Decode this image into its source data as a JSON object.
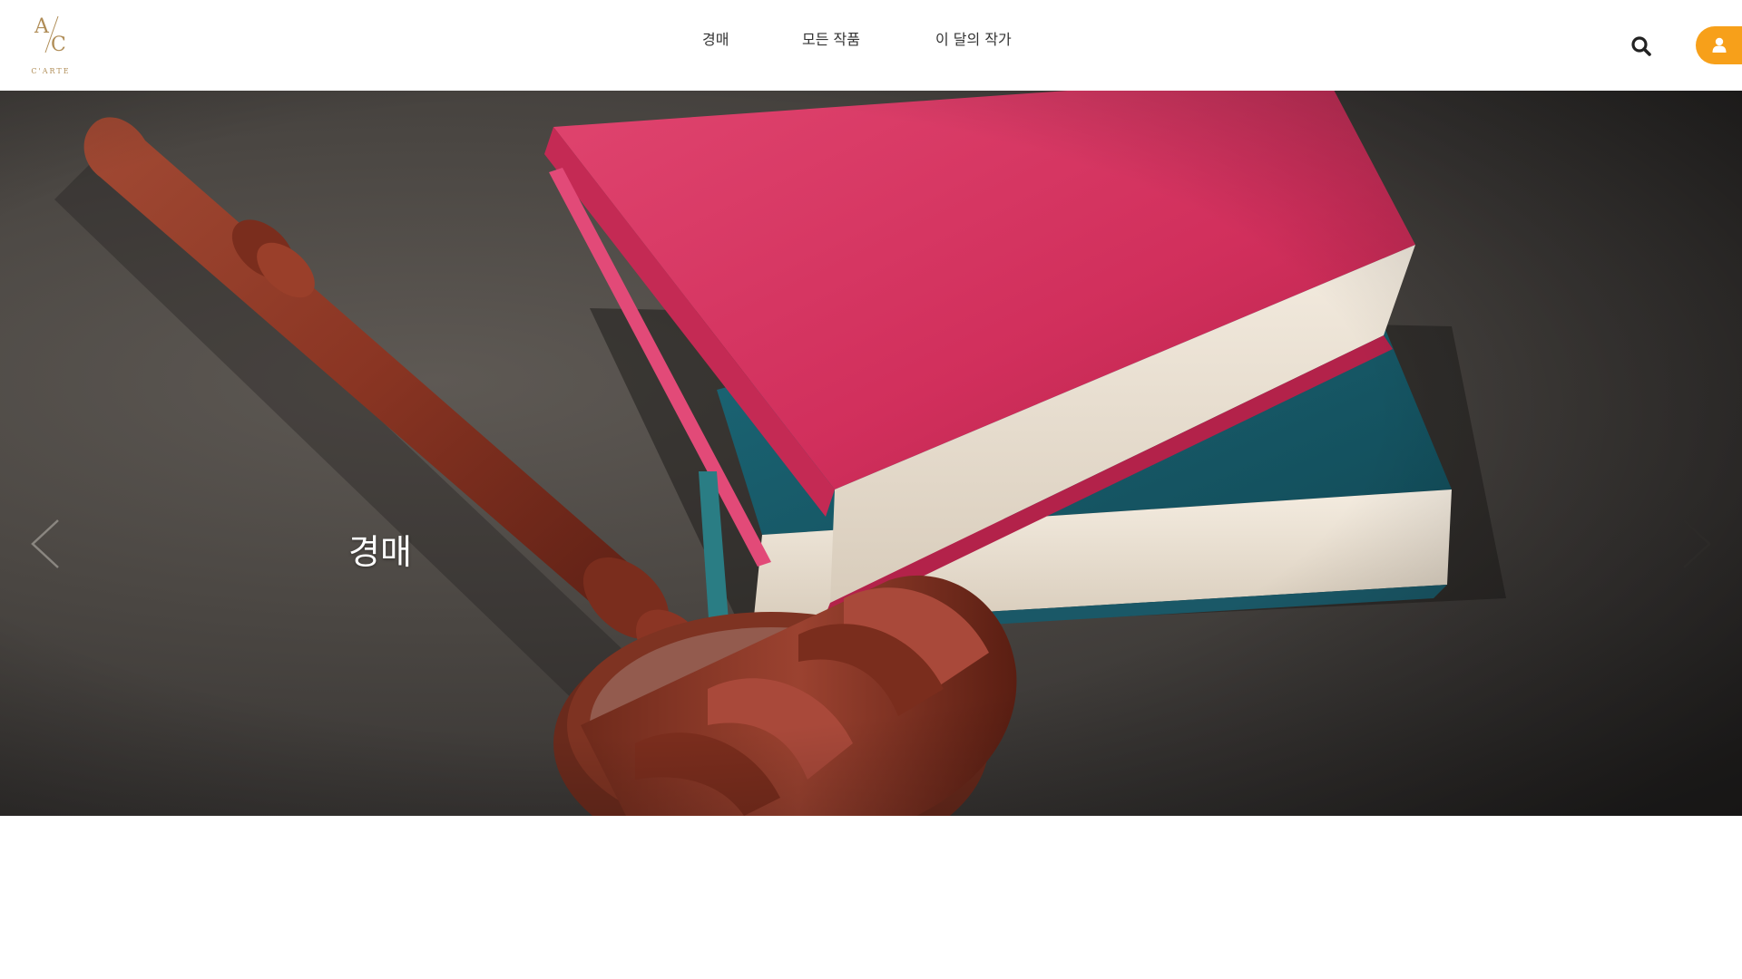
{
  "brand": {
    "logo_mark": "A/C",
    "logo_text": "C'ARTE",
    "accent_color": "#f7a01a",
    "logo_color": "#b08d57"
  },
  "nav": {
    "items": [
      {
        "label": "경매"
      },
      {
        "label": "모든 작품"
      },
      {
        "label": "이 달의 작가"
      }
    ]
  },
  "header": {
    "search_icon": "search-icon",
    "user_icon": "user-icon"
  },
  "hero": {
    "title": "경매",
    "image": "gavel-and-books-photo",
    "prev_icon": "chevron-left-icon",
    "next_icon": "chevron-right-icon"
  }
}
